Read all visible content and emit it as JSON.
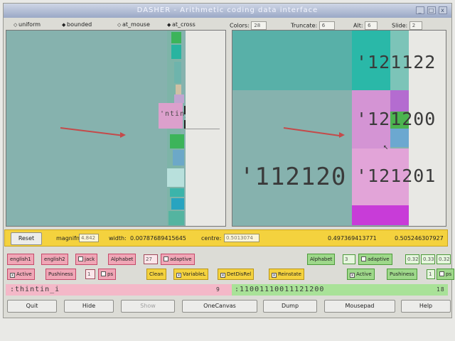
{
  "window": {
    "title": "DASHER - Arithmetic coding data interface",
    "min_glyph": "_",
    "max_glyph": "□",
    "close_glyph": "x"
  },
  "toolbar": {
    "uniform": "uniform",
    "bounded": "bounded",
    "at_mouse": "at_mouse",
    "at_cross": "at_cross",
    "colors_label": "Colors:",
    "colors_value": "28",
    "truncate_label": "Truncate:",
    "truncate_value": "6",
    "alt_label": "Alt:",
    "alt_value": "6",
    "slide_label": "Slide:",
    "slide_value": "2"
  },
  "left_canvas": {
    "label_text": "'ntin_i",
    "colors": {
      "bg": "#86b2ae",
      "pink": "#dca0cc",
      "green": "#3cb45a",
      "teal": "#28b4a0"
    }
  },
  "right_canvas": {
    "digits_main": "'112120",
    "digits_row1": "'121122",
    "digits_row2": "'121200",
    "digits_row3": "'121201",
    "colors": {
      "teal": "#2ab8a8",
      "pink": "#d494d4",
      "magenta": "#c83cd8",
      "green": "#4cb450"
    }
  },
  "status": {
    "reset": "Reset",
    "magnifn_label": "magnifn:",
    "magnifn_value": "4.842",
    "width_label": "width:",
    "width_value": "0.00787689415645",
    "centre_label": "centre:",
    "centre_value": "0.5013074",
    "lower": "0.497369413771",
    "upper": "0.50524630792​7"
  },
  "row_left": {
    "english1": "english1",
    "english2": "english2",
    "jack": "jack",
    "alphabet_label": "Alphabet",
    "alphabet_value": "27",
    "adaptive": "adaptive"
  },
  "row_right": {
    "alphabet_label": "Alphabet",
    "alphabet_value": "3",
    "adaptive": "adaptive",
    "v1": "0.32",
    "v2": "0.33",
    "v3": "0.32"
  },
  "row_bottom": {
    "active_left": "Active",
    "pushiness_left": "Pushiness",
    "pushiness_left_value": "1",
    "ps_left": "ps",
    "clean": "Clean",
    "variablel": "VariableL",
    "detdisrel": "DetDisRel",
    "reinstate": "Reinstate",
    "active_right": "Active",
    "pushiness_right": "Pushiness",
    "pushiness_right_value": "1",
    "ps_right": "ps"
  },
  "strings": {
    "input_text": ":thintin_i",
    "input_count": "9",
    "output_text": ":11001110011121200",
    "output_count": "18"
  },
  "buttons": {
    "quit": "Quit",
    "hide": "Hide",
    "show": "Show",
    "onecanvas": "OneCanvas",
    "dump": "Dump",
    "mousepad": "Mousepad",
    "help": "Help"
  }
}
